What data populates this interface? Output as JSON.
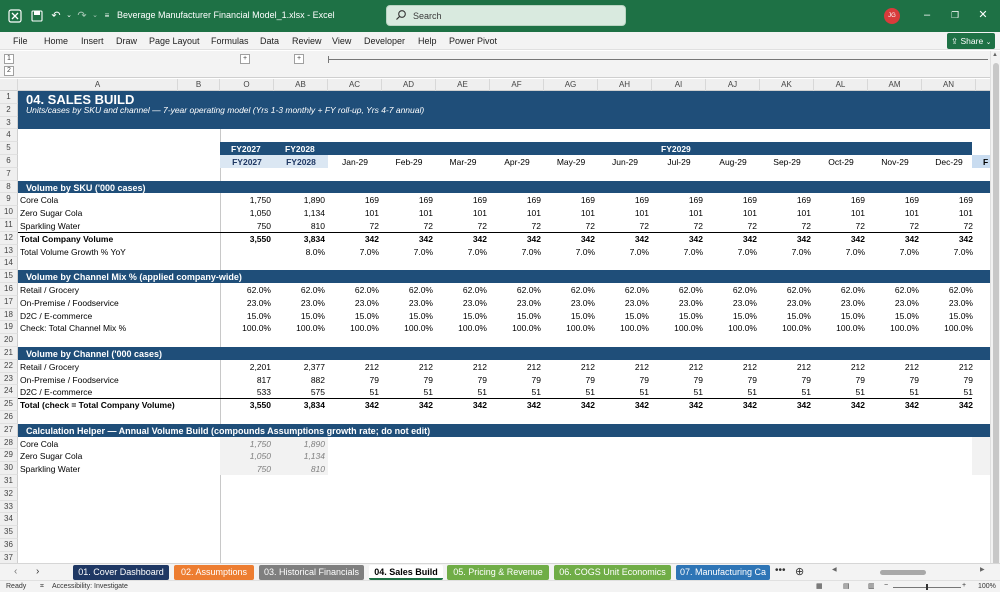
{
  "titlebar": {
    "doc_title": "Beverage Manufacturer Financial Model_1.xlsx  -  Excel",
    "search_placeholder": "Search",
    "avatar_initials": "JG"
  },
  "ribbon": {
    "tabs": [
      "File",
      "Home",
      "Insert",
      "Draw",
      "Page Layout",
      "Formulas",
      "Data",
      "Review",
      "View",
      "Developer",
      "Help",
      "Power Pivot"
    ],
    "share_label": "Share"
  },
  "outline": {
    "levels": [
      "1",
      "2"
    ],
    "buttons": [
      "+",
      "+"
    ]
  },
  "columns": [
    "A",
    "B",
    "O",
    "AB",
    "AC",
    "AD",
    "AE",
    "AF",
    "AG",
    "AH",
    "AI",
    "AJ",
    "AK",
    "AL",
    "AM",
    "AN"
  ],
  "rows": [
    "1",
    "2",
    "3",
    "4",
    "5",
    "6",
    "7",
    "8",
    "9",
    "10",
    "11",
    "12",
    "13",
    "14",
    "15",
    "16",
    "17",
    "18",
    "19",
    "20",
    "21",
    "22",
    "23",
    "24",
    "25",
    "26",
    "27",
    "28",
    "29",
    "30",
    "31",
    "32",
    "33",
    "34",
    "35",
    "36",
    "37"
  ],
  "sheet": {
    "title": "04.  SALES BUILD",
    "subtitle": "Units/cases by SKU and channel — 7-year operating model (Yrs 1-3 monthly + FY roll-up, Yrs 4-7 annual)",
    "row5": {
      "o": "FY2027",
      "ab": "FY2028",
      "ai": "FY2029"
    },
    "row6": [
      "FY2027",
      "FY2028",
      "Jan-29",
      "Feb-29",
      "Mar-29",
      "Apr-29",
      "May-29",
      "Jun-29",
      "Jul-29",
      "Aug-29",
      "Sep-29",
      "Oct-29",
      "Nov-29",
      "Dec-29",
      "F"
    ],
    "sec1": {
      "title": "Volume by SKU ('000 cases)",
      "rows": [
        {
          "label": "Core Cola",
          "vals": [
            "1,750",
            "1,890",
            "169",
            "169",
            "169",
            "169",
            "169",
            "169",
            "169",
            "169",
            "169",
            "169",
            "169",
            "169"
          ]
        },
        {
          "label": "Zero Sugar Cola",
          "vals": [
            "1,050",
            "1,134",
            "101",
            "101",
            "101",
            "101",
            "101",
            "101",
            "101",
            "101",
            "101",
            "101",
            "101",
            "101"
          ]
        },
        {
          "label": "Sparkling Water",
          "vals": [
            "750",
            "810",
            "72",
            "72",
            "72",
            "72",
            "72",
            "72",
            "72",
            "72",
            "72",
            "72",
            "72",
            "72"
          ]
        },
        {
          "label": "Total Company Volume",
          "vals": [
            "3,550",
            "3,834",
            "342",
            "342",
            "342",
            "342",
            "342",
            "342",
            "342",
            "342",
            "342",
            "342",
            "342",
            "342"
          ]
        },
        {
          "label": "  Total Volume Growth % YoY",
          "vals": [
            "",
            "8.0%",
            "7.0%",
            "7.0%",
            "7.0%",
            "7.0%",
            "7.0%",
            "7.0%",
            "7.0%",
            "7.0%",
            "7.0%",
            "7.0%",
            "7.0%",
            "7.0%"
          ]
        }
      ]
    },
    "sec2": {
      "title": "Volume by Channel Mix % (applied company-wide)",
      "rows": [
        {
          "label": "Retail / Grocery",
          "vals": [
            "62.0%",
            "62.0%",
            "62.0%",
            "62.0%",
            "62.0%",
            "62.0%",
            "62.0%",
            "62.0%",
            "62.0%",
            "62.0%",
            "62.0%",
            "62.0%",
            "62.0%",
            "62.0%"
          ]
        },
        {
          "label": "On-Premise / Foodservice",
          "vals": [
            "23.0%",
            "23.0%",
            "23.0%",
            "23.0%",
            "23.0%",
            "23.0%",
            "23.0%",
            "23.0%",
            "23.0%",
            "23.0%",
            "23.0%",
            "23.0%",
            "23.0%",
            "23.0%"
          ]
        },
        {
          "label": "D2C / E-commerce",
          "vals": [
            "15.0%",
            "15.0%",
            "15.0%",
            "15.0%",
            "15.0%",
            "15.0%",
            "15.0%",
            "15.0%",
            "15.0%",
            "15.0%",
            "15.0%",
            "15.0%",
            "15.0%",
            "15.0%"
          ]
        },
        {
          "label": "  Check: Total Channel Mix %",
          "vals": [
            "100.0%",
            "100.0%",
            "100.0%",
            "100.0%",
            "100.0%",
            "100.0%",
            "100.0%",
            "100.0%",
            "100.0%",
            "100.0%",
            "100.0%",
            "100.0%",
            "100.0%",
            "100.0%"
          ]
        }
      ]
    },
    "sec3": {
      "title": "Volume by Channel ('000 cases)",
      "rows": [
        {
          "label": "Retail / Grocery",
          "vals": [
            "2,201",
            "2,377",
            "212",
            "212",
            "212",
            "212",
            "212",
            "212",
            "212",
            "212",
            "212",
            "212",
            "212",
            "212"
          ]
        },
        {
          "label": "On-Premise / Foodservice",
          "vals": [
            "817",
            "882",
            "79",
            "79",
            "79",
            "79",
            "79",
            "79",
            "79",
            "79",
            "79",
            "79",
            "79",
            "79"
          ]
        },
        {
          "label": "D2C / E-commerce",
          "vals": [
            "533",
            "575",
            "51",
            "51",
            "51",
            "51",
            "51",
            "51",
            "51",
            "51",
            "51",
            "51",
            "51",
            "51"
          ]
        },
        {
          "label": "Total (check = Total Company Volume)",
          "vals": [
            "3,550",
            "3,834",
            "342",
            "342",
            "342",
            "342",
            "342",
            "342",
            "342",
            "342",
            "342",
            "342",
            "342",
            "342"
          ]
        }
      ]
    },
    "sec4": {
      "title": "Calculation Helper — Annual Volume Build (compounds Assumptions growth rate; do not edit)",
      "rows": [
        {
          "label": "    Core Cola",
          "vals": [
            "1,750",
            "1,890"
          ]
        },
        {
          "label": "    Zero Sugar Cola",
          "vals": [
            "1,050",
            "1,134"
          ]
        },
        {
          "label": "    Sparkling Water",
          "vals": [
            "750",
            "810"
          ]
        }
      ]
    }
  },
  "sheet_tabs": [
    {
      "label": "01. Cover Dashboard",
      "color": "#1f3864"
    },
    {
      "label": "02. Assumptions",
      "color": "#ed7d31"
    },
    {
      "label": "03. Historical Financials",
      "color": "#7f7f7f"
    },
    {
      "label": "04. Sales Build",
      "color": "#ffffff",
      "active": true
    },
    {
      "label": "05. Pricing & Revenue",
      "color": "#70ad47"
    },
    {
      "label": "06. COGS Unit Economics",
      "color": "#70ad47"
    },
    {
      "label": "07. Manufacturing Ca",
      "color": "#2e75b6"
    }
  ],
  "status": {
    "ready": "Ready",
    "accessibility": "Accessibility: Investigate",
    "zoom": "100%"
  }
}
